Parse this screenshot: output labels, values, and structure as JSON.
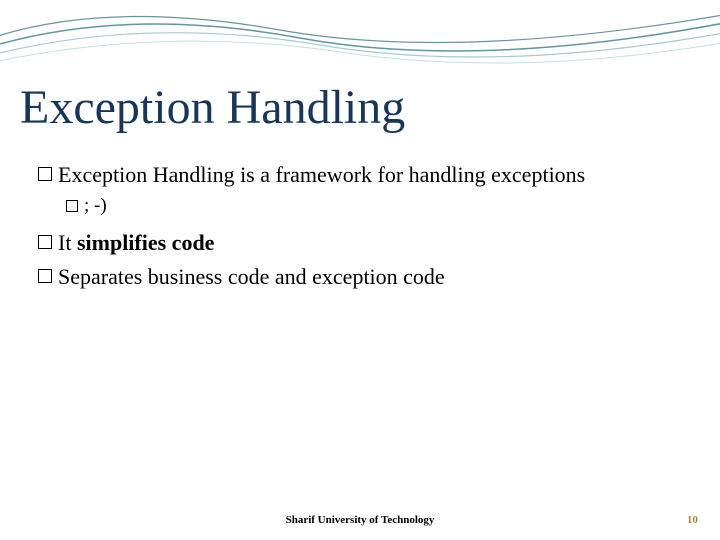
{
  "title": "Exception Handling",
  "bullets": {
    "b1": "Exception Handling is a framework for handling exceptions",
    "b1sub": "; -)",
    "b2_prefix": "It ",
    "b2_bold": "simplifies code",
    "b3": "Separates business code and exception code"
  },
  "footer": "Sharif University of Technology",
  "page": "10"
}
